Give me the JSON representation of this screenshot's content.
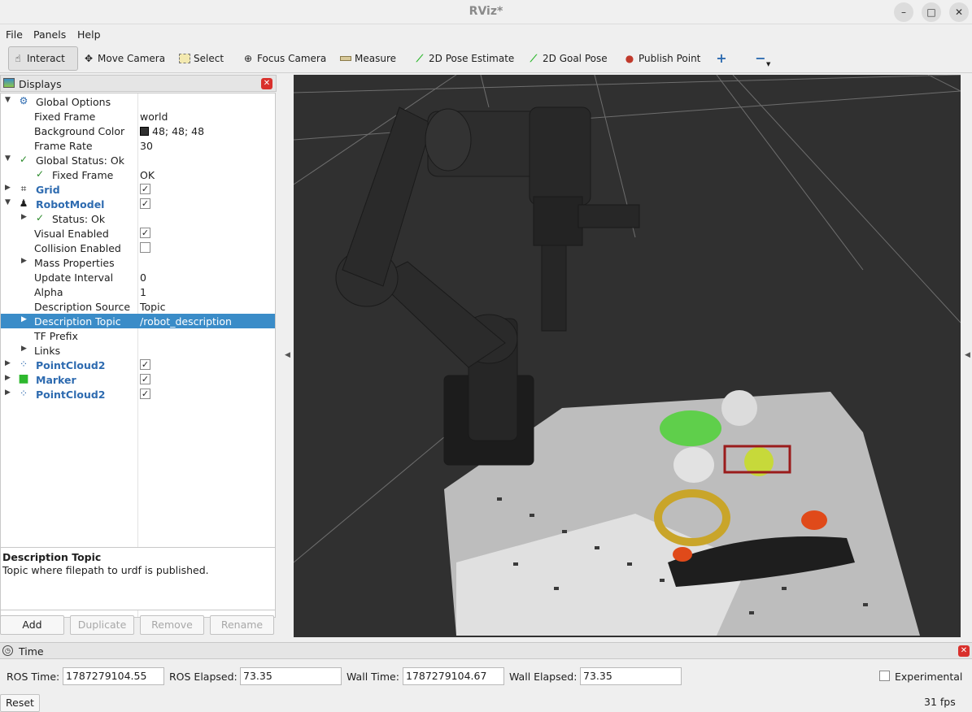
{
  "window": {
    "title": "RViz*"
  },
  "menu": {
    "file": "File",
    "panels": "Panels",
    "help": "Help"
  },
  "toolbar": {
    "interact": "Interact",
    "move_camera": "Move Camera",
    "select": "Select",
    "focus_camera": "Focus Camera",
    "measure": "Measure",
    "pose_estimate": "2D Pose Estimate",
    "goal_pose": "2D Goal Pose",
    "publish_point": "Publish Point",
    "accent": "#2e6bb0",
    "pose_color": "#2eb82e",
    "point_color": "#c0392b"
  },
  "displays": {
    "title": "Displays",
    "rows": [
      {
        "label": "Global Options"
      },
      {
        "label": "Fixed Frame",
        "value": "world"
      },
      {
        "label": "Background Color",
        "value": "48; 48; 48"
      },
      {
        "label": "Frame Rate",
        "value": "30"
      },
      {
        "label": "Global Status: Ok"
      },
      {
        "label": "Fixed Frame",
        "value": "OK"
      },
      {
        "label": "Grid",
        "checked": true
      },
      {
        "label": "RobotModel",
        "checked": true
      },
      {
        "label": "Status: Ok"
      },
      {
        "label": "Visual Enabled",
        "checked": true
      },
      {
        "label": "Collision Enabled",
        "checked": false
      },
      {
        "label": "Mass Properties"
      },
      {
        "label": "Update Interval",
        "value": "0"
      },
      {
        "label": "Alpha",
        "value": "1"
      },
      {
        "label": "Description Source",
        "value": "Topic"
      },
      {
        "label": "Description Topic",
        "value": "/robot_description"
      },
      {
        "label": "TF Prefix"
      },
      {
        "label": "Links"
      },
      {
        "label": "PointCloud2",
        "checked": true
      },
      {
        "label": "Marker",
        "checked": true
      },
      {
        "label": "PointCloud2",
        "checked": true
      }
    ],
    "selected_color": "#3a8cc8",
    "description": {
      "title": "Description Topic",
      "text": "Topic where filepath to urdf is published."
    },
    "buttons": {
      "add": "Add",
      "duplicate": "Duplicate",
      "remove": "Remove",
      "rename": "Rename"
    }
  },
  "viewport": {
    "background": "#303030"
  },
  "time": {
    "title": "Time",
    "ros_time_label": "ROS Time:",
    "ros_time": "1787279104.55",
    "ros_elapsed_label": "ROS Elapsed:",
    "ros_elapsed": "73.35",
    "wall_time_label": "Wall Time:",
    "wall_time": "1787279104.67",
    "wall_elapsed_label": "Wall Elapsed:",
    "wall_elapsed": "73.35",
    "experimental_label": "Experimental",
    "experimental_checked": false,
    "reset": "Reset",
    "fps": "31 fps"
  }
}
